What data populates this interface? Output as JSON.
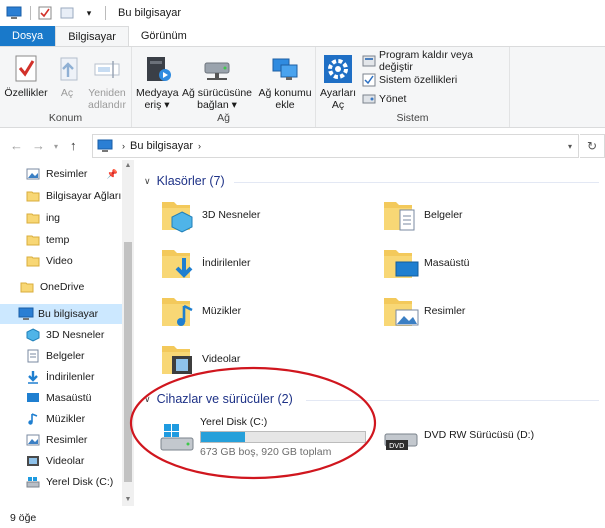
{
  "window": {
    "title": "Bu bilgisayar"
  },
  "ribbon": {
    "tabs": [
      "Dosya",
      "Bilgisayar",
      "Görünüm"
    ],
    "groups": {
      "konum": {
        "label": "Konum",
        "buttons": [
          "Özellikler",
          "Aç",
          "Yeniden adlandır"
        ]
      },
      "ag": {
        "label": "Ağ",
        "buttons": [
          "Medyaya eriş",
          "Ağ sürücüsüne bağlan",
          "Ağ konumu ekle"
        ]
      },
      "sistem": {
        "label": "Sistem",
        "big_button": "Ayarları Aç",
        "small_buttons": [
          "Program kaldır veya değiştir",
          "Sistem özellikleri",
          "Yönet"
        ]
      }
    }
  },
  "address": {
    "path": "Bu bilgisayar"
  },
  "nav_pane": {
    "items": [
      {
        "label": "Resimler",
        "icon": "pictures-icon",
        "pinned": true
      },
      {
        "label": "Bilgisayar Ağları",
        "icon": "folder-icon"
      },
      {
        "label": "ing",
        "icon": "folder-icon"
      },
      {
        "label": "temp",
        "icon": "folder-icon"
      },
      {
        "label": "Video",
        "icon": "folder-icon"
      },
      {
        "label": "OneDrive",
        "icon": "onedrive-icon"
      },
      {
        "label": "Bu bilgisayar",
        "icon": "computer-icon",
        "selected": true
      },
      {
        "label": "3D Nesneler",
        "icon": "3d-objects-icon"
      },
      {
        "label": "Belgeler",
        "icon": "documents-icon"
      },
      {
        "label": "İndirilenler",
        "icon": "downloads-icon"
      },
      {
        "label": "Masaüstü",
        "icon": "desktop-icon"
      },
      {
        "label": "Müzikler",
        "icon": "music-icon"
      },
      {
        "label": "Resimler",
        "icon": "pictures-icon"
      },
      {
        "label": "Videolar",
        "icon": "videos-icon"
      },
      {
        "label": "Yerel Disk (C:)",
        "icon": "local-disk-icon"
      }
    ]
  },
  "main": {
    "folders_header": "Klasörler (7)",
    "folders": [
      {
        "label": "3D Nesneler",
        "icon": "3d-objects-icon"
      },
      {
        "label": "Belgeler",
        "icon": "documents-icon"
      },
      {
        "label": "İndirilenler",
        "icon": "downloads-icon"
      },
      {
        "label": "Masaüstü",
        "icon": "desktop-icon"
      },
      {
        "label": "Müzikler",
        "icon": "music-icon"
      },
      {
        "label": "Resimler",
        "icon": "pictures-icon"
      },
      {
        "label": "Videolar",
        "icon": "videos-icon"
      }
    ],
    "drives_header": "Cihazlar ve sürücüler (2)",
    "drives": [
      {
        "label": "Yerel Disk (C:)",
        "icon": "local-disk-icon",
        "detail": "673 GB boş, 920 GB toplam",
        "used_fraction": 0.27
      },
      {
        "label": "DVD RW Sürücüsü (D:)",
        "icon": "dvd-drive-icon"
      }
    ]
  },
  "status": {
    "item_count": "9 öğe"
  },
  "colors": {
    "accent": "#1979ca",
    "header_text": "#1e3287",
    "selection": "#cce8ff",
    "annotation": "#d0161e",
    "folder": "#f8d775"
  }
}
